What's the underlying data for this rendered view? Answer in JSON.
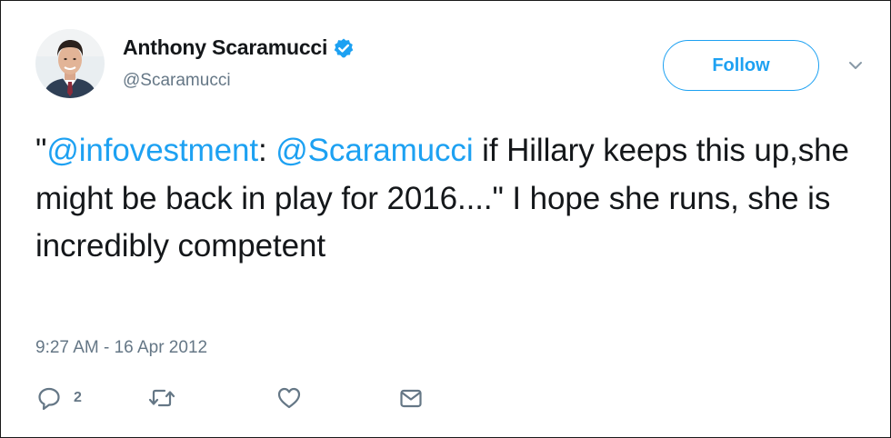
{
  "user": {
    "display_name": "Anthony Scaramucci",
    "handle": "@Scaramucci",
    "verified_icon": "verified-badge-icon",
    "avatar_icon": "profile-photo"
  },
  "follow_button": {
    "label": "Follow"
  },
  "menu": {
    "icon": "chevron-down-icon"
  },
  "tweet": {
    "open_quote": "\"",
    "mention_1": "@infovestment",
    "colon": ": ",
    "mention_2": "@Scaramucci",
    "body": " if Hillary keeps this up,she might be back in play for 2016....\" I hope she runs, she is incredibly competent",
    "timestamp": "9:27 AM - 16 Apr 2012"
  },
  "actions": {
    "reply": {
      "icon": "reply-icon",
      "count": "2"
    },
    "retweet": {
      "icon": "retweet-icon"
    },
    "like": {
      "icon": "heart-icon"
    },
    "message": {
      "icon": "envelope-icon"
    }
  },
  "colors": {
    "accent": "#1da1f2",
    "secondary_text": "#657786",
    "primary_text": "#14171a"
  }
}
